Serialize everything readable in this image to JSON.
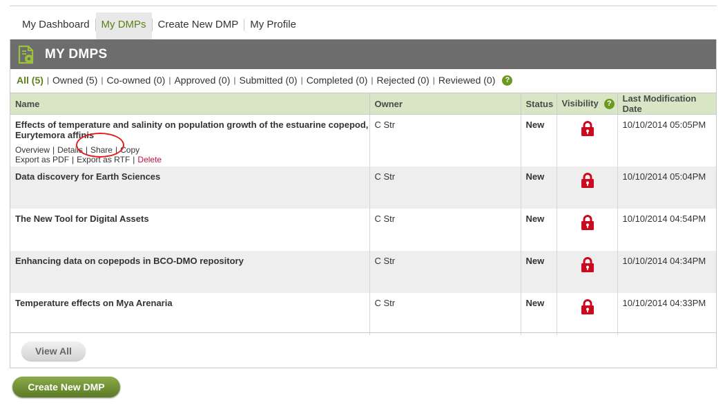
{
  "nav": {
    "tabs": [
      {
        "label": "My Dashboard"
      },
      {
        "label": "My DMPs"
      },
      {
        "label": "Create New DMP"
      },
      {
        "label": "My Profile"
      }
    ],
    "active_tab": "My DMPs"
  },
  "header": {
    "title": "MY DMPS",
    "icon": "document-gear-icon"
  },
  "filters": [
    {
      "label": "All (5)"
    },
    {
      "label": "Owned (5)"
    },
    {
      "label": "Co-owned (0)"
    },
    {
      "label": "Approved (0)"
    },
    {
      "label": "Submitted (0)"
    },
    {
      "label": "Completed (0)"
    },
    {
      "label": "Rejected (0)"
    },
    {
      "label": "Reviewed (0)"
    }
  ],
  "table": {
    "columns": [
      "Name",
      "Owner",
      "Status",
      "Visibility",
      "Last Modification Date"
    ],
    "rows": [
      {
        "name": "Effects of temperature and salinity on population growth of the estuarine copepod, Eurytemora affinis",
        "owner": "C Str",
        "status": "New",
        "visibility": "lock-icon",
        "date": "10/10/2014 05:05PM",
        "actions": {
          "overview": "Overview",
          "details": "Details",
          "share": "Share",
          "copy": "Copy",
          "export_pdf": "Export as PDF",
          "export_rtf": "Export as RTF",
          "delete": "Delete"
        }
      },
      {
        "name": "Data discovery for Earth Sciences",
        "owner": "C Str",
        "status": "New",
        "visibility": "lock-icon",
        "date": "10/10/2014 05:04PM"
      },
      {
        "name": "The New Tool for Digital Assets",
        "owner": "C Str",
        "status": "New",
        "visibility": "lock-icon",
        "date": "10/10/2014 04:54PM"
      },
      {
        "name": "Enhancing data on copepods in BCO-DMO repository",
        "owner": "C Str",
        "status": "New",
        "visibility": "lock-icon",
        "date": "10/10/2014 04:34PM"
      },
      {
        "name": "Temperature effects on Mya Arenaria",
        "owner": "C Str",
        "status": "New",
        "visibility": "lock-icon",
        "date": "10/10/2014 04:33PM"
      }
    ]
  },
  "buttons": {
    "view_all": "View All",
    "create_new": "Create New DMP"
  },
  "colors": {
    "accent_green": "#5e7d16",
    "header_gray": "#6d6d6d",
    "table_header": "#d9e6c5",
    "lock_red": "#cc0a1f",
    "delete_red": "#c0103c"
  }
}
